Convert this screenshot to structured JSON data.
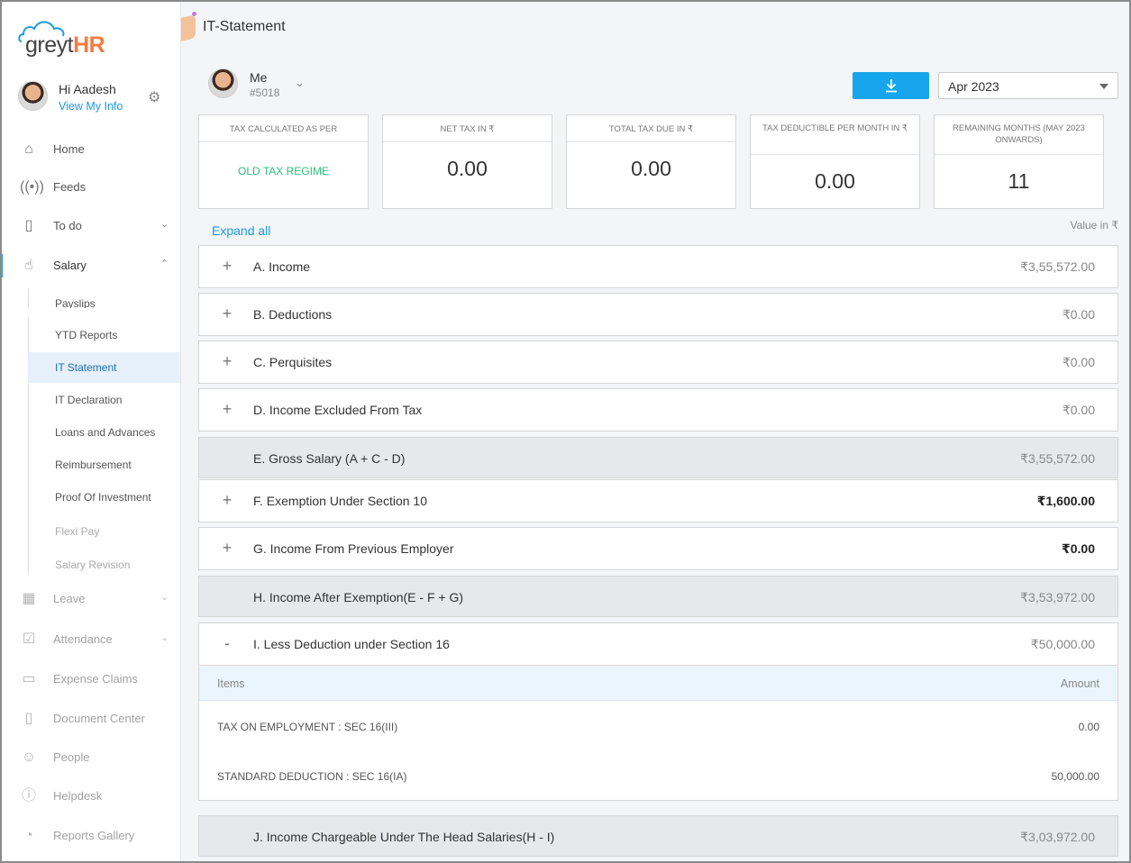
{
  "app": {
    "logo_prefix": "greyt",
    "logo_suffix": "HR",
    "greeting": "Hi Aadesh",
    "view_my_info": "View My Info"
  },
  "nav": {
    "home": "Home",
    "feeds": "Feeds",
    "todo": "To do",
    "salary": "Salary",
    "leave": "Leave",
    "attendance": "Attendance",
    "expense": "Expense Claims",
    "document": "Document Center",
    "people": "People",
    "helpdesk": "Helpdesk",
    "reports": "Reports Gallery"
  },
  "salary_sub": {
    "payslips": "Payslips",
    "ytd": "YTD Reports",
    "it_statement": "IT Statement",
    "it_declaration": "IT Declaration",
    "loans": "Loans and Advances",
    "reimbursement": "Reimbursement",
    "proof": "Proof Of Investment",
    "flexi": "Flexi Pay",
    "revision": "Salary Revision"
  },
  "page": {
    "title": "IT-Statement",
    "employee_name": "Me",
    "employee_code": "#5018",
    "period": "Apr 2023",
    "expand_all": "Expand all",
    "value_in": "Value in ₹"
  },
  "cards": {
    "regime_head": "TAX CALCULATED AS PER",
    "regime_value": "OLD TAX REGIME",
    "net_tax_head": "NET TAX IN ₹",
    "net_tax_value": "0.00",
    "total_due_head": "TOTAL TAX DUE IN ₹",
    "total_due_value": "0.00",
    "per_month_head": "TAX DEDUCTIBLE PER MONTH IN ₹",
    "per_month_value": "0.00",
    "remaining_head": "REMAINING MONTHS (MAY 2023 ONWARDS)",
    "remaining_value": "11"
  },
  "sections": {
    "a": {
      "label": "A. Income",
      "amount": "₹3,55,572.00"
    },
    "b": {
      "label": "B. Deductions",
      "amount": "₹0.00"
    },
    "c": {
      "label": "C. Perquisites",
      "amount": "₹0.00"
    },
    "d": {
      "label": "D. Income Excluded From Tax",
      "amount": "₹0.00"
    },
    "e": {
      "label": "E. Gross Salary (A + C - D)",
      "amount": "₹3,55,572.00"
    },
    "f": {
      "label": "F. Exemption Under Section 10",
      "amount": "₹1,600.00"
    },
    "g": {
      "label": "G. Income From Previous Employer",
      "amount": "₹0.00"
    },
    "h": {
      "label": "H. Income After Exemption(E - F + G)",
      "amount": "₹3,53,972.00"
    },
    "i": {
      "label": "I. Less Deduction under Section 16",
      "amount": "₹50,000.00"
    },
    "j": {
      "label": "J. Income Chargeable Under The Head Salaries(H - I)",
      "amount": "₹3,03,972.00"
    }
  },
  "plus": "+",
  "minus": "-",
  "detail": {
    "col_items": "Items",
    "col_amount": "Amount",
    "rows": [
      {
        "item": "TAX ON EMPLOYMENT : SEC 16(III)",
        "amount": "0.00"
      },
      {
        "item": "STANDARD DEDUCTION : SEC 16(IA)",
        "amount": "50,000.00"
      }
    ]
  }
}
